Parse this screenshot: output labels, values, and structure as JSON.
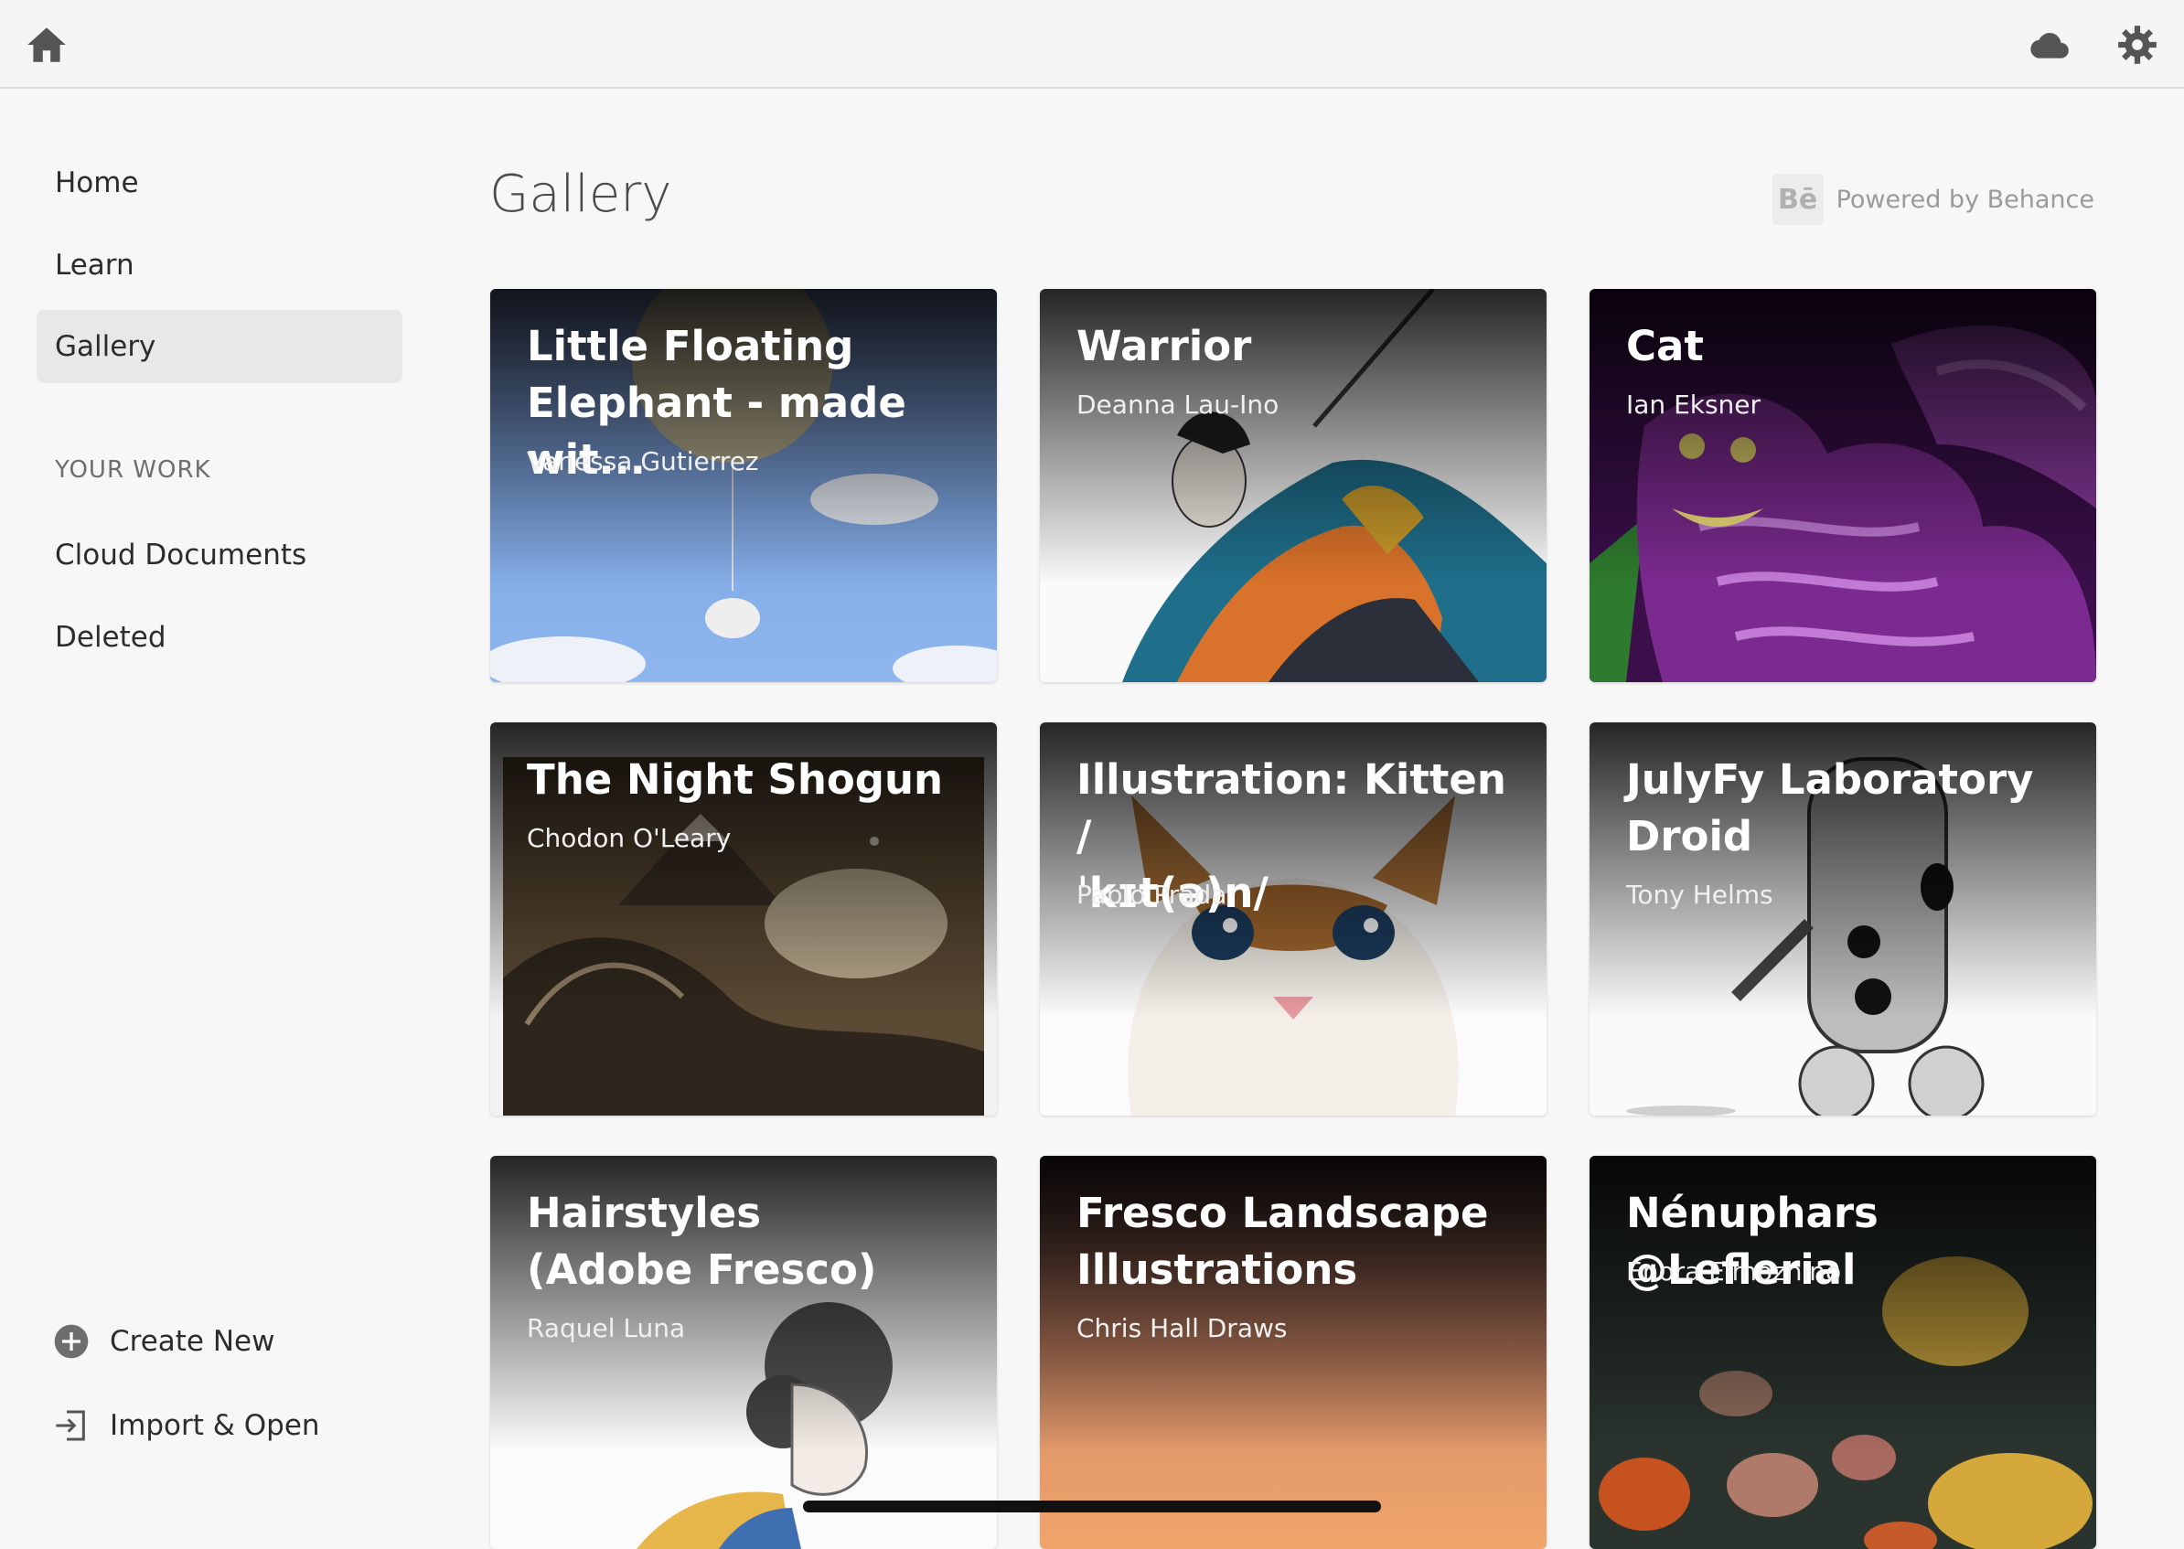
{
  "topbar": {
    "home_icon": "home-icon",
    "cloud_icon": "cloud-icon",
    "settings_icon": "gear-icon"
  },
  "sidebar": {
    "nav": [
      {
        "label": "Home"
      },
      {
        "label": "Learn"
      },
      {
        "label": "Gallery",
        "active": true
      }
    ],
    "section_label": "YOUR WORK",
    "work": [
      {
        "label": "Cloud Documents"
      },
      {
        "label": "Deleted"
      }
    ],
    "actions": [
      {
        "label": "Create New",
        "icon": "plus-circle-icon"
      },
      {
        "label": "Import & Open",
        "icon": "import-icon"
      }
    ]
  },
  "main": {
    "title": "Gallery",
    "behance_logo": "Bē",
    "powered_by": "Powered by Behance",
    "cards": [
      {
        "title": "Little Floating\nElephant - made wit...",
        "author": "Vanessa Gutierrez"
      },
      {
        "title": "Warrior",
        "author": "Deanna Lau-Ino"
      },
      {
        "title": "Cat",
        "author": "Ian Eksner"
      },
      {
        "title": "The Night Shogun",
        "author": "Chodon O'Leary"
      },
      {
        "title": "Illustration: Kitten /\nˈkɪt(ə)n/",
        "author": "Pablo Prada"
      },
      {
        "title": "JulyFy Laboratory\nDroid",
        "author": "Tony Helms"
      },
      {
        "title": "Hairstyles\n(Adobe Fresco)",
        "author": "Raquel Luna"
      },
      {
        "title": "Fresco Landscape\nIllustrations",
        "author": "Chris Hall Draws"
      },
      {
        "title": "Nénuphars @Leflerial",
        "author": "Enora Elmoznino"
      }
    ]
  },
  "colors": {
    "background": "#f7f7f7",
    "active_nav": "#e8e8e8",
    "text": "#2c2c2c"
  }
}
